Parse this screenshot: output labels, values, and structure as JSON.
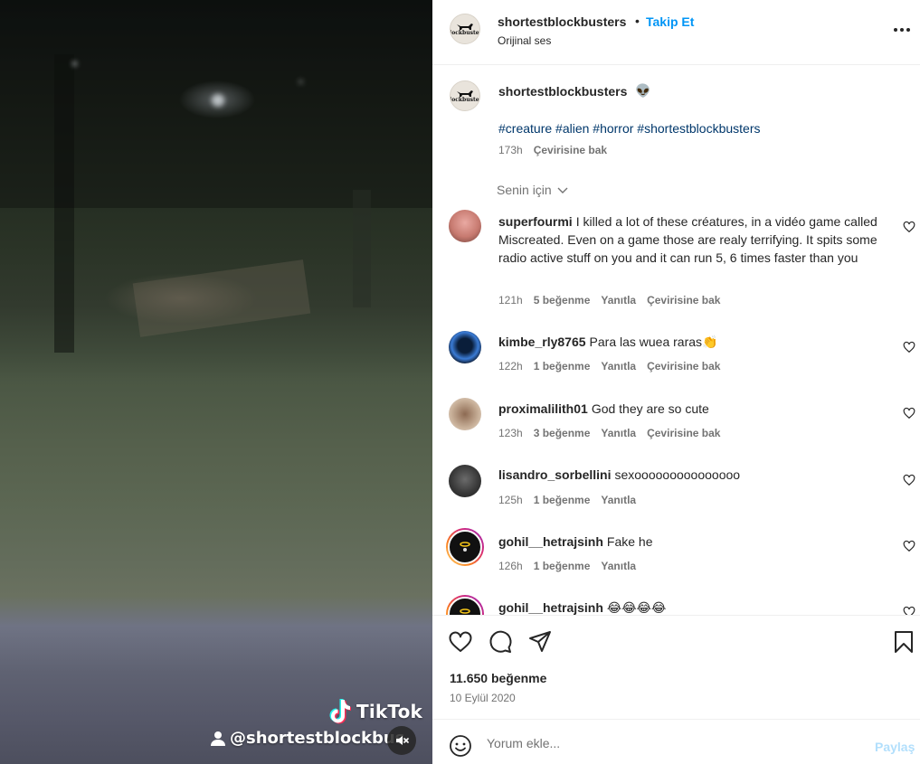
{
  "video": {
    "watermark_brand": "TikTok",
    "watermark_user": "@shortestblockbus",
    "mute_icon": "muted-speaker-icon"
  },
  "header": {
    "username": "shortestblockbusters",
    "separator": "•",
    "follow_label": "Takip Et",
    "audio": "Orijinal ses",
    "more_icon": "more-options-icon"
  },
  "caption": {
    "username": "shortestblockbusters",
    "emoji": "👽",
    "hashtags": "#creature #alien #horror #shortestblockbusters",
    "time": "173h",
    "translate": "Çevirisine bak"
  },
  "sort": {
    "label": "Senin için"
  },
  "comments": [
    {
      "username": "superfourmi",
      "text": "I killed a lot of these créatures, in a vidéo game called Miscreated. Even on a game those are realy terrifying. It spits some radio active stuff on you and it can run 5, 6 times faster than you",
      "time": "121h",
      "likes": "5 beğenme",
      "reply": "Yanıtla",
      "translate": "Çevirisine bak"
    },
    {
      "username": "kimbe_rly8765",
      "text": "Para las wuea raras👏",
      "time": "122h",
      "likes": "1 beğenme",
      "reply": "Yanıtla",
      "translate": "Çevirisine bak"
    },
    {
      "username": "proximalilith01",
      "text": "God they are so cute",
      "time": "123h",
      "likes": "3 beğenme",
      "reply": "Yanıtla",
      "translate": "Çevirisine bak"
    },
    {
      "username": "lisandro_sorbellini",
      "text": "sexooooooooooooooo",
      "time": "125h",
      "likes": "1 beğenme",
      "reply": "Yanıtla"
    },
    {
      "username": "gohil__hetrajsinh",
      "text": "Fake he",
      "time": "126h",
      "likes": "1 beğenme",
      "reply": "Yanıtla"
    },
    {
      "username": "gohil__hetrajsinh",
      "text": "😂😂😂😂"
    }
  ],
  "actions": {
    "like_icon": "heart-icon",
    "comment_icon": "comment-icon",
    "share_icon": "share-icon",
    "save_icon": "bookmark-icon",
    "likes": "11.650 beğenme",
    "date": "10 Eylül 2020"
  },
  "add_comment": {
    "placeholder": "Yorum ekle...",
    "post_label": "Paylaş",
    "emoji_icon": "emoji-icon"
  },
  "colors": {
    "link_blue": "#0095f6",
    "hashtag": "#00376b",
    "muted_text": "#737373",
    "post_disabled": "#b2dffc"
  }
}
